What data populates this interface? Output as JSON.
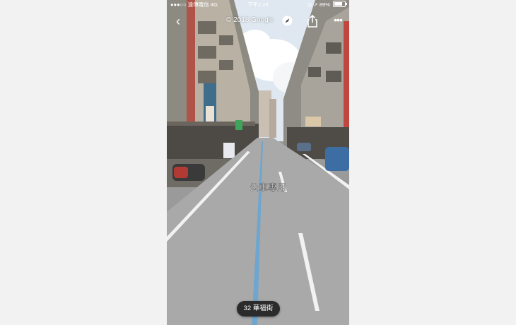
{
  "status_bar": {
    "signal_dots": "●●●○○",
    "carrier": "遠傳電信",
    "network": "4G",
    "time": "下午2:28",
    "battery_percent": "89%",
    "battery_level": 0.89
  },
  "toolbar": {
    "back_glyph": "‹",
    "copyright": "© 2018 Google",
    "more_glyph": "•••"
  },
  "street_markings": {
    "road_text": "公車專用"
  },
  "address_chip": {
    "label": "32 華福街"
  },
  "colors": {
    "road": "#a9a9a9",
    "bus_lane_line": "#6ea6cf",
    "lane_line": "#f2f2f2",
    "sky": "#dfe8f1",
    "chip_bg": "#2b2b2b"
  }
}
